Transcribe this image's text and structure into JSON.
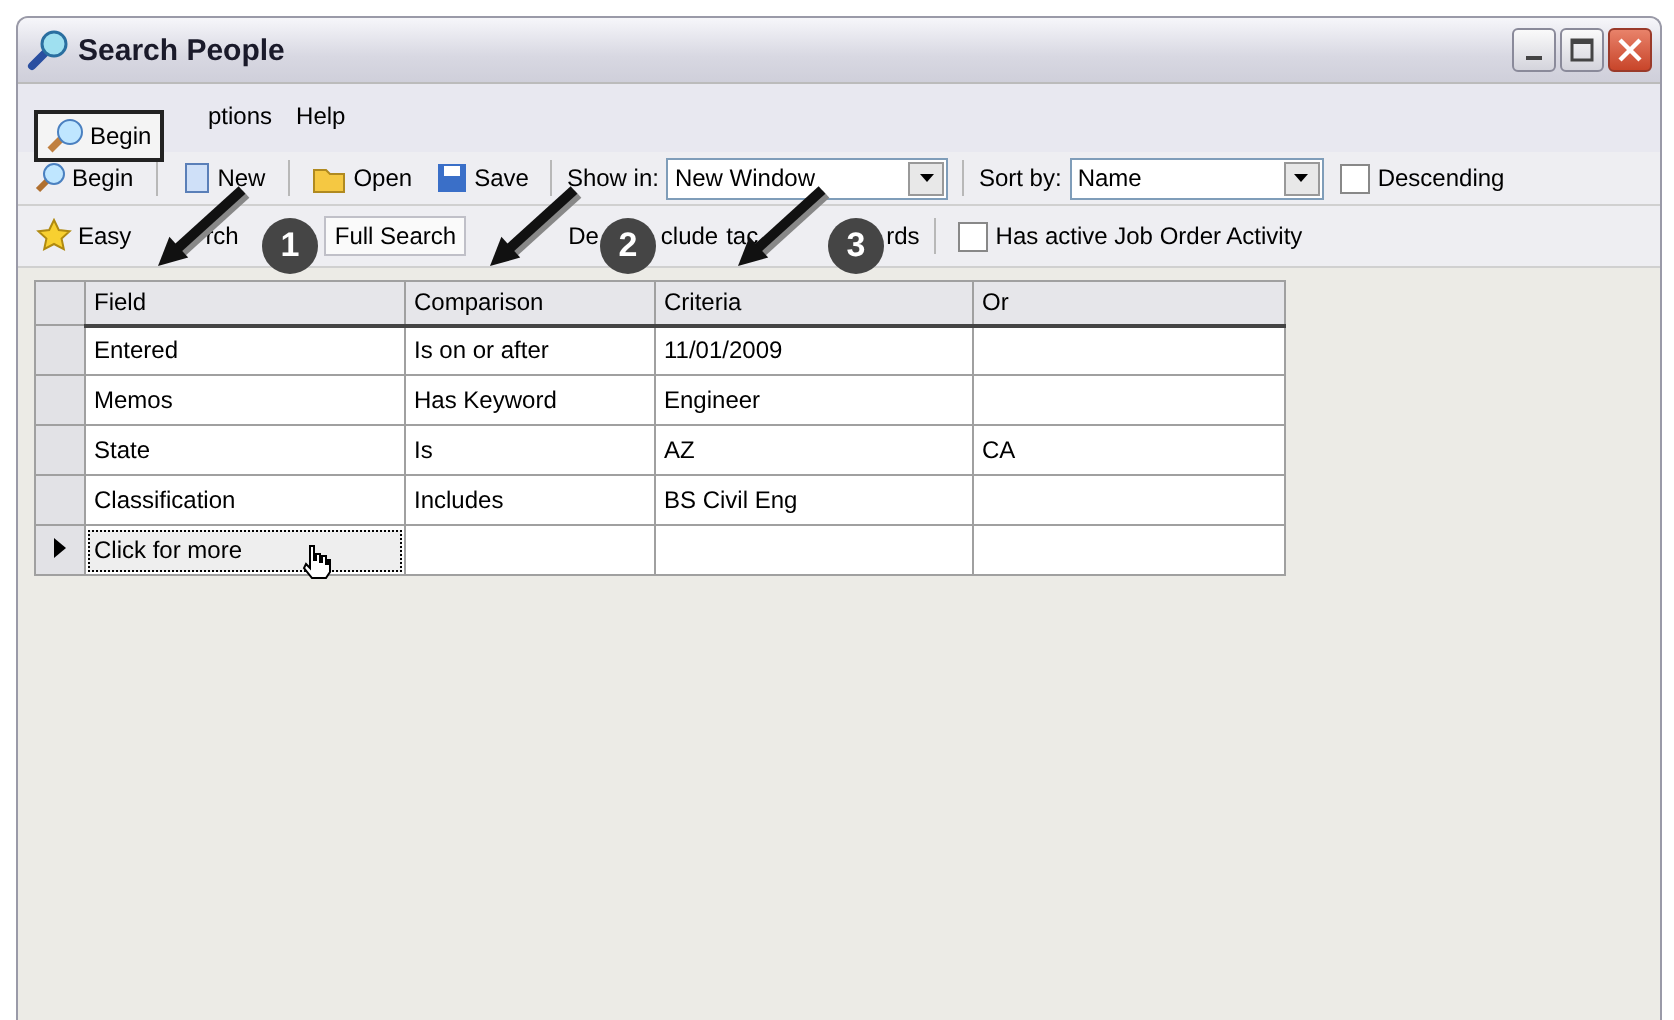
{
  "window": {
    "title": "Search People"
  },
  "menu": [
    "ptions",
    "Help"
  ],
  "tooltip": "Begin",
  "toolbar": {
    "begin": "Begin",
    "new": "New",
    "open": "Open",
    "save": "Save",
    "show_in": {
      "label": "Show in:",
      "value": "New Window"
    },
    "sort_by": {
      "label": "Sort by:",
      "value": "Name"
    },
    "descending": {
      "label": "Descending",
      "checked": false
    }
  },
  "search_bar": {
    "easy_search": {
      "parts": [
        "Easy",
        "rch"
      ],
      "selected": false
    },
    "full_search": {
      "label": "Full Search",
      "selected": true
    },
    "fragments": [
      "De",
      "clude",
      "tac",
      "rds"
    ],
    "job_order": {
      "label": "Has active Job Order Activity",
      "checked": false
    }
  },
  "callouts": [
    "1",
    "2",
    "3"
  ],
  "grid": {
    "columns": [
      "Field",
      "Comparison",
      "Criteria",
      "Or"
    ],
    "rows": [
      {
        "cells": [
          "Entered",
          "Is on or after",
          "11/01/2009",
          ""
        ],
        "current": false
      },
      {
        "cells": [
          "Memos",
          "Has Keyword",
          "Engineer",
          ""
        ],
        "current": false
      },
      {
        "cells": [
          "State",
          "Is",
          "AZ",
          "CA"
        ],
        "current": false
      },
      {
        "cells": [
          "Classification",
          "Includes",
          "BS Civil Eng",
          ""
        ],
        "current": false
      },
      {
        "cells": [
          "Click for more",
          "",
          "",
          ""
        ],
        "current": true
      }
    ]
  }
}
